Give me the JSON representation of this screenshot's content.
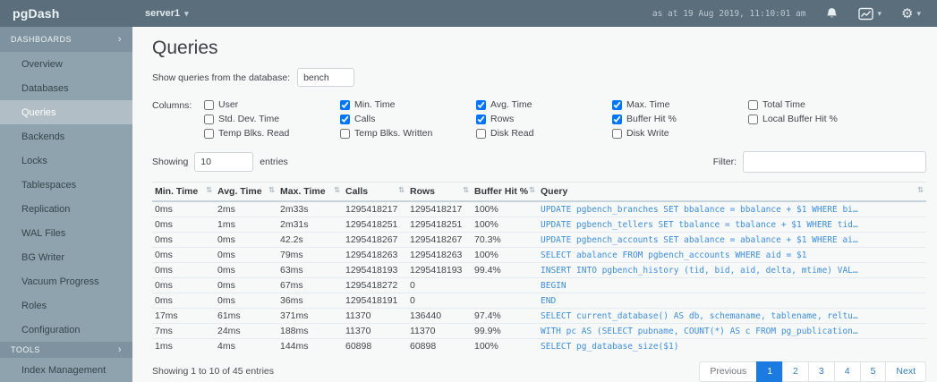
{
  "colors": {
    "topbar": "#5b6e7b",
    "sidebar": "#8ea3ad",
    "sidebar_active": "#b1bec6",
    "accent_blue": "#1b7be0",
    "query_text": "#3d8fe4"
  },
  "topbar": {
    "brand": "pgDash",
    "server": "server1",
    "timestamp": "as at 19 Aug 2019, 11:10:01 am",
    "icons": [
      "bell-icon",
      "charts-icon",
      "gear-icon"
    ]
  },
  "sidebar": {
    "sections": [
      {
        "header": "DASHBOARDS",
        "items": [
          "Overview",
          "Databases",
          "Queries",
          "Backends",
          "Locks",
          "Tablespaces",
          "Replication",
          "WAL Files",
          "BG Writer",
          "Vacuum Progress",
          "Roles",
          "Configuration"
        ],
        "active_item": "Queries"
      },
      {
        "header": "TOOLS",
        "items": [
          "Index Management"
        ],
        "active_item": ""
      }
    ]
  },
  "main": {
    "title": "Queries",
    "db_label": "Show queries from the database:",
    "db_value": "bench",
    "columns_label": "Columns:",
    "column_groups": [
      [
        {
          "label": "User",
          "checked": false
        },
        {
          "label": "Std. Dev. Time",
          "checked": false
        },
        {
          "label": "Temp Blks. Read",
          "checked": false
        }
      ],
      [
        {
          "label": "Min. Time",
          "checked": true
        },
        {
          "label": "Calls",
          "checked": true
        },
        {
          "label": "Temp Blks. Written",
          "checked": false
        }
      ],
      [
        {
          "label": "Avg. Time",
          "checked": true
        },
        {
          "label": "Rows",
          "checked": true
        },
        {
          "label": "Disk Read",
          "checked": false
        }
      ],
      [
        {
          "label": "Max. Time",
          "checked": true
        },
        {
          "label": "Buffer Hit %",
          "checked": true
        },
        {
          "label": "Disk Write",
          "checked": false
        }
      ],
      [
        {
          "label": "Total Time",
          "checked": false
        },
        {
          "label": "Local Buffer Hit %",
          "checked": false
        }
      ]
    ],
    "showing_label": "Showing",
    "entries_value": "10",
    "entries_label": "entries",
    "filter_label": "Filter:",
    "filter_value": "",
    "table": {
      "headers": [
        "Min. Time",
        "Avg. Time",
        "Max. Time",
        "Calls",
        "Rows",
        "Buffer Hit %",
        "Query"
      ],
      "rows": [
        [
          "0ms",
          "2ms",
          "2m33s",
          "1295418217",
          "1295418217",
          "100%",
          "UPDATE pgbench_branches SET bbalance = bbalance + $1 WHERE bi…"
        ],
        [
          "0ms",
          "1ms",
          "2m31s",
          "1295418251",
          "1295418251",
          "100%",
          "UPDATE pgbench_tellers SET tbalance = tbalance + $1 WHERE tid…"
        ],
        [
          "0ms",
          "0ms",
          "42.2s",
          "1295418267",
          "1295418267",
          "70.3%",
          "UPDATE pgbench_accounts SET abalance = abalance + $1 WHERE ai…"
        ],
        [
          "0ms",
          "0ms",
          "79ms",
          "1295418263",
          "1295418263",
          "100%",
          "SELECT abalance FROM pgbench_accounts WHERE aid = $1"
        ],
        [
          "0ms",
          "0ms",
          "63ms",
          "1295418193",
          "1295418193",
          "99.4%",
          "INSERT INTO pgbench_history (tid, bid, aid, delta, mtime) VAL…"
        ],
        [
          "0ms",
          "0ms",
          "67ms",
          "1295418272",
          "0",
          "",
          "BEGIN"
        ],
        [
          "0ms",
          "0ms",
          "36ms",
          "1295418191",
          "0",
          "",
          "END"
        ],
        [
          "17ms",
          "61ms",
          "371ms",
          "11370",
          "136440",
          "97.4%",
          "SELECT current_database() AS db, schemaname, tablename, reltu…"
        ],
        [
          "7ms",
          "24ms",
          "188ms",
          "11370",
          "11370",
          "99.9%",
          "WITH pc AS (SELECT pubname, COUNT(*) AS c FROM pg_publication…"
        ],
        [
          "1ms",
          "4ms",
          "144ms",
          "60898",
          "60898",
          "100%",
          "SELECT pg_database_size($1)"
        ]
      ]
    },
    "footer": {
      "summary": "Showing 1 to 10 of 45 entries",
      "pagination": [
        "Previous",
        "1",
        "2",
        "3",
        "4",
        "5",
        "Next"
      ],
      "active_page": "1"
    }
  }
}
